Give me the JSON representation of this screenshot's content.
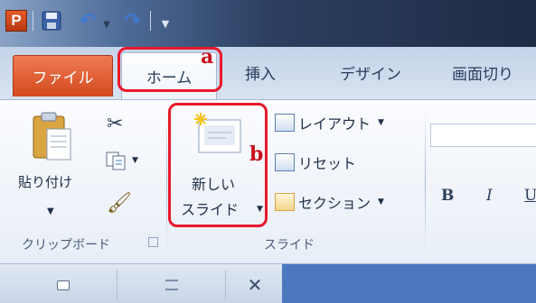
{
  "quick_access": {
    "app_logo": "P",
    "icons": [
      "powerpoint-logo-icon",
      "save-icon",
      "undo-icon",
      "redo-icon",
      "customize-toolbar-icon"
    ]
  },
  "tabs": [
    {
      "label": "ファイル",
      "active": false
    },
    {
      "label": "ホーム",
      "active": true
    },
    {
      "label": "挿入",
      "active": false
    },
    {
      "label": "デザイン",
      "active": false
    },
    {
      "label": "画面切り",
      "active": false
    }
  ],
  "ribbon": {
    "clipboard": {
      "paste_label": "貼り付け",
      "group_label": "クリップボード",
      "icons": [
        "paste-icon",
        "cut-icon",
        "copy-icon",
        "format-painter-icon",
        "dialog-launcher-icon"
      ]
    },
    "slides": {
      "new_slide_line1": "新しい",
      "new_slide_line2": "スライド",
      "layout_label": "レイアウト",
      "reset_label": "リセット",
      "section_label": "セクション",
      "group_label": "スライド"
    },
    "font": {
      "bold_label": "B",
      "italic_label": "I",
      "underline_label": "U"
    }
  },
  "annotations": {
    "a": "a",
    "b": "b",
    "color": "#e8192b"
  },
  "colors": {
    "file_tab": "#d24a1e",
    "accent_blue": "#4d78bf"
  }
}
